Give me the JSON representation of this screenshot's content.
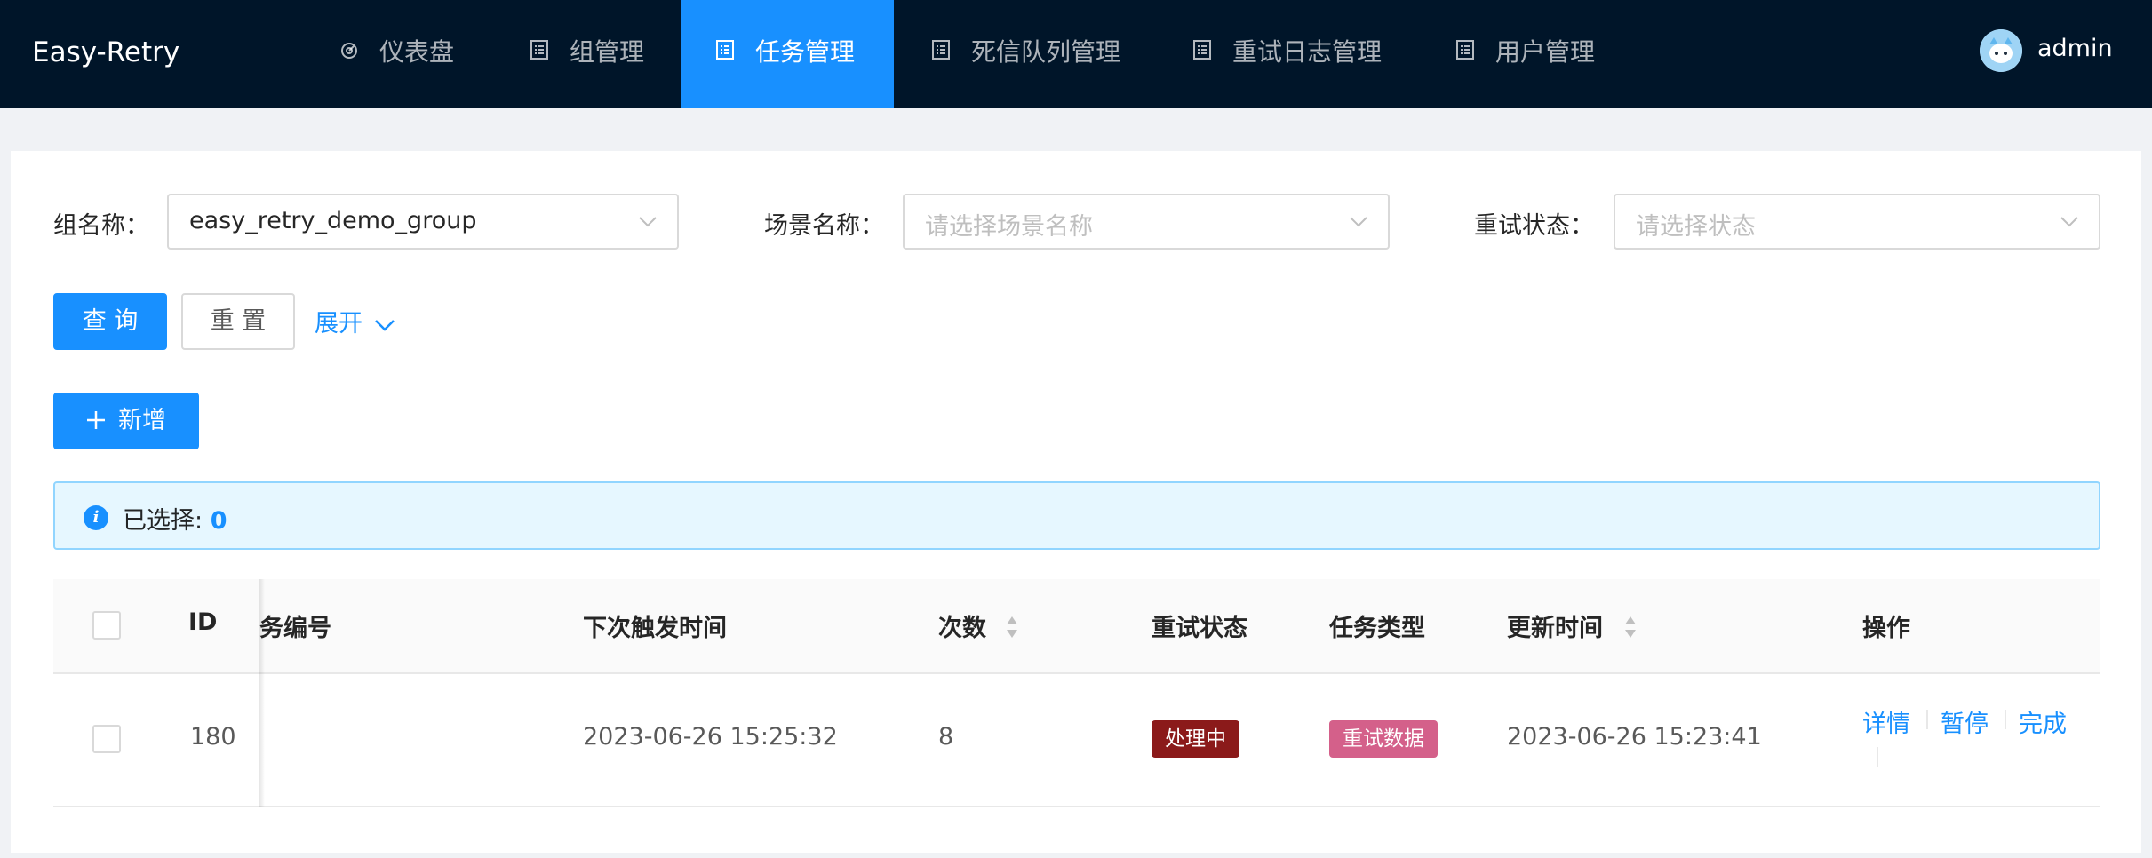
{
  "app": {
    "title": "Easy-Retry"
  },
  "nav": {
    "items": [
      {
        "label": "仪表盘",
        "icon": "dashboard-icon",
        "active": false
      },
      {
        "label": "组管理",
        "icon": "list-icon",
        "active": false
      },
      {
        "label": "任务管理",
        "icon": "list-icon",
        "active": true
      },
      {
        "label": "死信队列管理",
        "icon": "list-icon",
        "active": false
      },
      {
        "label": "重试日志管理",
        "icon": "list-icon",
        "active": false
      },
      {
        "label": "用户管理",
        "icon": "list-icon",
        "active": false
      }
    ]
  },
  "user": {
    "name": "admin",
    "avatar_icon": "avatar-icon"
  },
  "filters": {
    "group": {
      "label": "组名称：",
      "value": "easy_retry_demo_group"
    },
    "scene": {
      "label": "场景名称：",
      "placeholder": "请选择场景名称"
    },
    "status": {
      "label": "重试状态：",
      "placeholder": "请选择状态"
    }
  },
  "buttons": {
    "query": "查 询",
    "reset": "重 置",
    "expand": "展开",
    "add": "新增"
  },
  "selection": {
    "label": "已选择: ",
    "count": "0"
  },
  "table": {
    "columns": {
      "id": "ID",
      "task_no": "务编号",
      "next_trigger": "下次触发时间",
      "count": "次数",
      "retry_status": "重试状态",
      "task_type": "任务类型",
      "updated": "更新时间",
      "actions": "操作"
    },
    "rows": [
      {
        "id": "180",
        "task_no": "",
        "next_trigger": "2023-06-26 15:25:32",
        "count": "8",
        "retry_status": "处理中",
        "task_type": "重试数据",
        "updated": "2023-06-26 15:23:41",
        "actions": {
          "detail": "详情",
          "pause": "暂停",
          "finish": "完成"
        }
      }
    ]
  },
  "colors": {
    "header_bg": "#001529",
    "primary": "#1890ff",
    "status_processing": "#8b1a1a",
    "type_retry_data": "#d4608a"
  }
}
